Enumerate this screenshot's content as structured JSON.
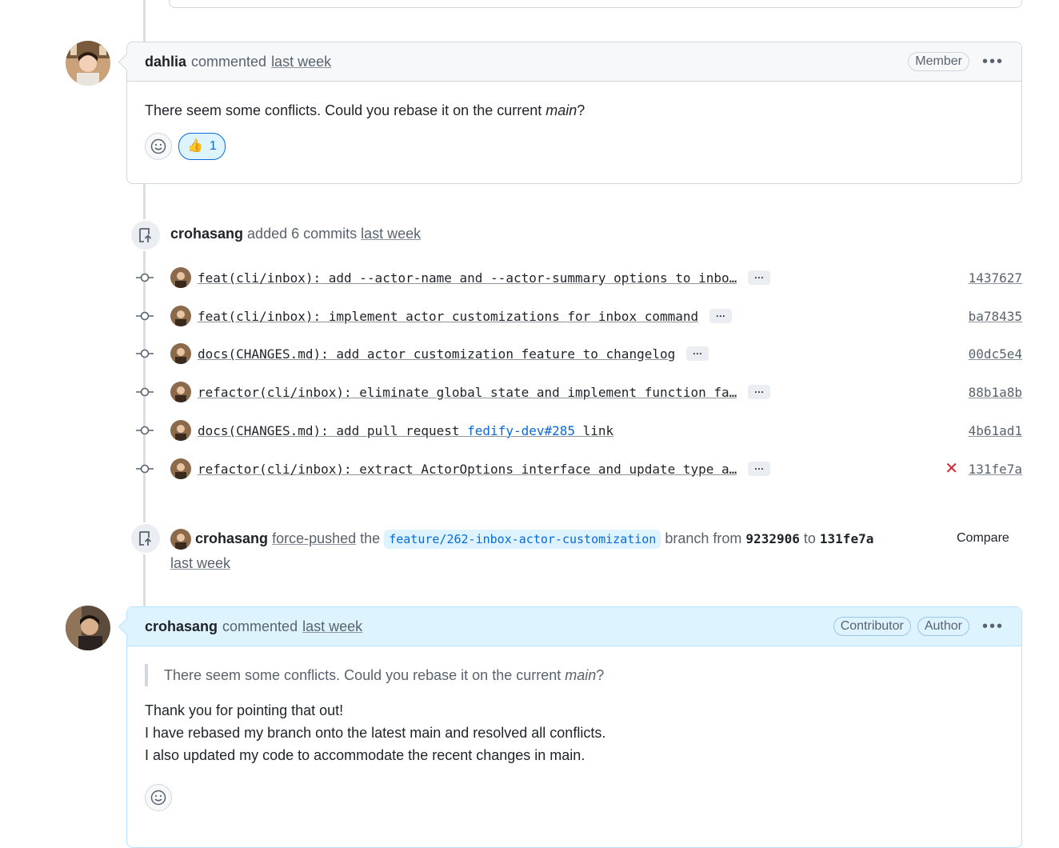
{
  "comment1": {
    "author": "dahlia",
    "action": "commented",
    "time": "last week",
    "badge": "Member",
    "body_pre": "There seem some conflicts. Could you rebase it on the current ",
    "body_em": "main",
    "body_post": "?",
    "reaction_emoji": "👍",
    "reaction_count": "1"
  },
  "commits_event": {
    "author": "crohasang",
    "action": "added 6 commits",
    "time": "last week",
    "commits": [
      {
        "message": "feat(cli/inbox): add --actor-name and --actor-summary options to inbo…",
        "sha": "1437627",
        "status": ""
      },
      {
        "message": "feat(cli/inbox): implement actor customizations for inbox command",
        "sha": "ba78435",
        "status": ""
      },
      {
        "message": "docs(CHANGES.md): add actor customization feature to changelog",
        "sha": "00dc5e4",
        "status": ""
      },
      {
        "message": "refactor(cli/inbox): eliminate global state and implement function fa…",
        "sha": "88b1a8b",
        "status": ""
      },
      {
        "message_pre": "docs(CHANGES.md): add pull request ",
        "message_link": "fedify-dev#285",
        "message_post": " link",
        "sha": "4b61ad1",
        "status": ""
      },
      {
        "message": "refactor(cli/inbox): extract ActorOptions interface and update type a…",
        "sha": "131fe7a",
        "status": "failed"
      }
    ]
  },
  "force_push": {
    "author": "crohasang",
    "action": "force-pushed",
    "the": "the",
    "branch": "feature/262-inbox-actor-customization",
    "branch_from": "branch from",
    "from_sha": "9232906",
    "to": "to",
    "to_sha": "131fe7a",
    "time": "last week",
    "compare": "Compare"
  },
  "comment2": {
    "author": "crohasang",
    "action": "commented",
    "time": "last week",
    "badges": [
      "Contributor",
      "Author"
    ],
    "quote_pre": "There seem some conflicts. Could you rebase it on the current ",
    "quote_em": "main",
    "quote_post": "?",
    "lines": [
      "Thank you for pointing that out!",
      "I have rebased my branch onto the latest main and resolved all conflicts.",
      "I also updated my code to accommodate the recent changes in main."
    ]
  },
  "colors": {
    "link": "#0969da",
    "fail": "#d1242f",
    "author_header": "#ddf4ff"
  }
}
